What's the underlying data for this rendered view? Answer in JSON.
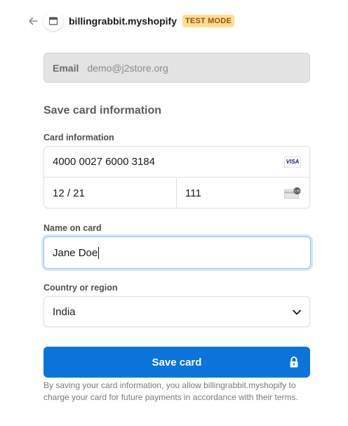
{
  "header": {
    "store_name": "billingrabbit.myshopify",
    "badge": "TEST MODE",
    "back_icon": "arrow-left-icon",
    "logo_icon": "store-icon"
  },
  "email": {
    "label": "Email",
    "value": "demo@j2store.org"
  },
  "section_title": "Save card information",
  "card": {
    "label": "Card information",
    "number": "4000 0027 6000 3184",
    "brand": "VISA",
    "expiry": "12 / 21",
    "cvc": "111",
    "cvc_icon_text": "135"
  },
  "name": {
    "label": "Name on card",
    "value": "Jane Doe"
  },
  "country": {
    "label": "Country or region",
    "value": "India"
  },
  "save_button": {
    "label": "Save card"
  },
  "terms": "By saving your card information, you allow billingrabbit.myshopify to charge your card for future payments in accordance with their terms.",
  "colors": {
    "accent": "#0a74da",
    "badge_bg": "#ffde92",
    "badge_text": "#a04f01",
    "focus_border": "#97c1e8"
  }
}
